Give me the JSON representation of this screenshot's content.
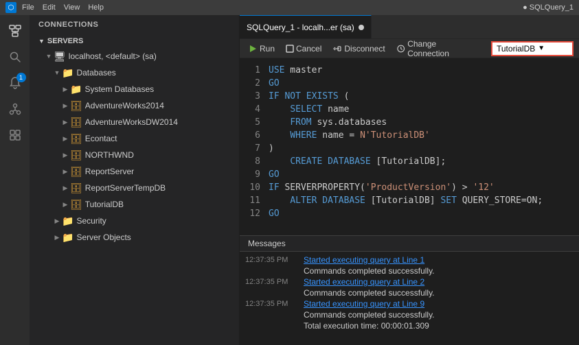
{
  "titleBar": {
    "menuItems": [
      "File",
      "Edit",
      "View",
      "Help"
    ],
    "appIcon": "●",
    "title": "● SQLQuery_1"
  },
  "activityBar": {
    "icons": [
      {
        "name": "connections-icon",
        "symbol": "⊞",
        "active": true
      },
      {
        "name": "search-icon",
        "symbol": "🔍",
        "active": false
      },
      {
        "name": "notifications-icon",
        "symbol": "🔔",
        "active": false,
        "badge": "1"
      },
      {
        "name": "git-icon",
        "symbol": "⎇",
        "active": false
      },
      {
        "name": "extensions-icon",
        "symbol": "⊟",
        "active": false
      }
    ]
  },
  "sidebar": {
    "header": "CONNECTIONS",
    "sections": [
      {
        "title": "SERVERS",
        "items": [
          {
            "label": "localhost, <default> (sa)",
            "icon": "server",
            "indent": 1,
            "expanded": true
          },
          {
            "label": "Databases",
            "icon": "folder",
            "indent": 2,
            "expanded": true
          },
          {
            "label": "System Databases",
            "icon": "folder",
            "indent": 3,
            "expanded": false
          },
          {
            "label": "AdventureWorks2014",
            "icon": "db",
            "indent": 3,
            "expanded": false
          },
          {
            "label": "AdventureWorksDW2014",
            "icon": "db",
            "indent": 3,
            "expanded": false
          },
          {
            "label": "Econtact",
            "icon": "db",
            "indent": 3,
            "expanded": false
          },
          {
            "label": "NORTHWND",
            "icon": "db",
            "indent": 3,
            "expanded": false
          },
          {
            "label": "ReportServer",
            "icon": "db",
            "indent": 3,
            "expanded": false
          },
          {
            "label": "ReportServerTempDB",
            "icon": "db",
            "indent": 3,
            "expanded": false
          },
          {
            "label": "TutorialDB",
            "icon": "db",
            "indent": 3,
            "expanded": false
          },
          {
            "label": "Security",
            "icon": "folder",
            "indent": 2,
            "expanded": false
          },
          {
            "label": "Server Objects",
            "icon": "folder",
            "indent": 2,
            "expanded": false
          }
        ]
      }
    ]
  },
  "tab": {
    "label": "SQLQuery_1 - localh...er (sa)",
    "modified": true
  },
  "toolbar": {
    "runLabel": "Run",
    "cancelLabel": "Cancel",
    "disconnectLabel": "Disconnect",
    "changeConnectionLabel": "Change Connection",
    "dbSelectorValue": "TutorialDB"
  },
  "codeLines": [
    {
      "num": 1,
      "tokens": [
        {
          "type": "kw",
          "text": "USE"
        },
        {
          "type": "plain",
          "text": " master"
        }
      ]
    },
    {
      "num": 2,
      "tokens": [
        {
          "type": "kw",
          "text": "GO"
        }
      ]
    },
    {
      "num": 3,
      "tokens": [
        {
          "type": "kw",
          "text": "IF NOT EXISTS"
        },
        {
          "type": "plain",
          "text": " ("
        }
      ]
    },
    {
      "num": 4,
      "tokens": [
        {
          "type": "plain",
          "text": "    "
        },
        {
          "type": "kw",
          "text": "SELECT"
        },
        {
          "type": "plain",
          "text": " name"
        }
      ]
    },
    {
      "num": 5,
      "tokens": [
        {
          "type": "plain",
          "text": "    "
        },
        {
          "type": "kw",
          "text": "FROM"
        },
        {
          "type": "plain",
          "text": " sys.databases"
        }
      ]
    },
    {
      "num": 6,
      "tokens": [
        {
          "type": "plain",
          "text": "    "
        },
        {
          "type": "kw",
          "text": "WHERE"
        },
        {
          "type": "plain",
          "text": " name = "
        },
        {
          "type": "str",
          "text": "N'TutorialDB'"
        }
      ]
    },
    {
      "num": 7,
      "tokens": [
        {
          "type": "plain",
          "text": ")"
        }
      ]
    },
    {
      "num": 8,
      "tokens": [
        {
          "type": "plain",
          "text": "    "
        },
        {
          "type": "kw",
          "text": "CREATE DATABASE"
        },
        {
          "type": "plain",
          "text": " [TutorialDB];"
        }
      ]
    },
    {
      "num": 9,
      "tokens": [
        {
          "type": "kw",
          "text": "GO"
        }
      ]
    },
    {
      "num": 10,
      "tokens": [
        {
          "type": "kw",
          "text": "IF"
        },
        {
          "type": "plain",
          "text": " SERVERPROPERTY("
        },
        {
          "type": "str",
          "text": "'ProductVersion'"
        },
        {
          "type": "plain",
          "text": ") > "
        },
        {
          "type": "str",
          "text": "'12'"
        }
      ]
    },
    {
      "num": 11,
      "tokens": [
        {
          "type": "plain",
          "text": "    "
        },
        {
          "type": "kw",
          "text": "ALTER DATABASE"
        },
        {
          "type": "plain",
          "text": " [TutorialDB] "
        },
        {
          "type": "kw",
          "text": "SET"
        },
        {
          "type": "plain",
          "text": " QUERY_STORE=ON;"
        }
      ]
    },
    {
      "num": 12,
      "tokens": [
        {
          "type": "kw",
          "text": "GO"
        }
      ]
    }
  ],
  "messages": {
    "header": "Messages",
    "rows": [
      {
        "time": "12:37:35 PM",
        "text": "Started executing query at Line 1",
        "link": true
      },
      {
        "time": "",
        "text": "Commands completed successfully.",
        "link": false
      },
      {
        "time": "12:37:35 PM",
        "text": "Started executing query at Line 2",
        "link": true
      },
      {
        "time": "",
        "text": "Commands completed successfully.",
        "link": false
      },
      {
        "time": "12:37:35 PM",
        "text": "Started executing query at Line 9",
        "link": true
      },
      {
        "time": "",
        "text": "Commands completed successfully.",
        "link": false
      },
      {
        "time": "",
        "text": "Total execution time: 00:00:01.309",
        "link": false
      }
    ]
  }
}
